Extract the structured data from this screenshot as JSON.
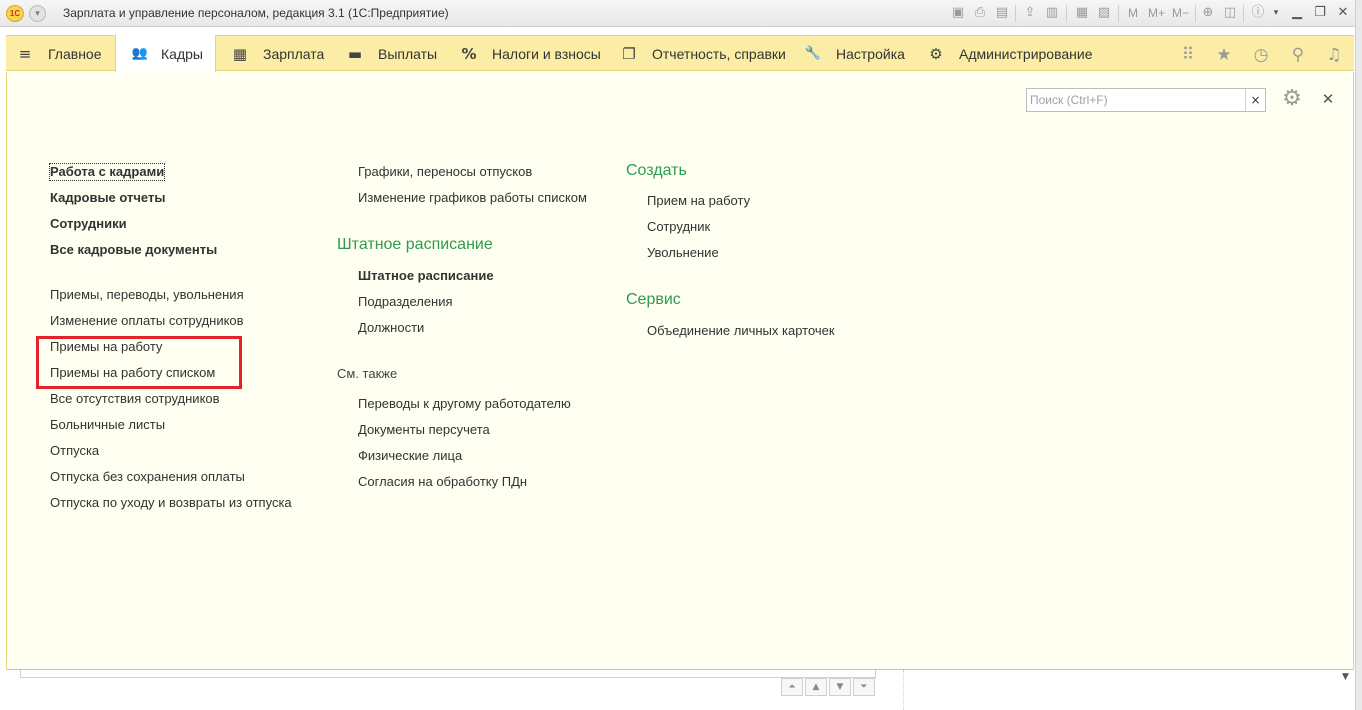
{
  "window": {
    "title": "Зарплата и управление персоналом, редакция 3.1  (1С:Предприятие)",
    "logo_text": "1С",
    "toolbar_text": {
      "m": "M",
      "m_plus": "M+",
      "m_minus": "M−"
    }
  },
  "nav": {
    "items": [
      {
        "label": "Главное",
        "icon": "hamburger-icon",
        "glyph": "≡"
      },
      {
        "label": "Кадры",
        "icon": "people-icon",
        "glyph": "👥",
        "active": true
      },
      {
        "label": "Зарплата",
        "icon": "calculator-icon",
        "glyph": "▦"
      },
      {
        "label": "Выплаты",
        "icon": "wallet-icon",
        "glyph": "▬"
      },
      {
        "label": "Налоги и взносы",
        "icon": "percent-icon",
        "glyph": "%"
      },
      {
        "label": "Отчетность, справки",
        "icon": "documents-icon",
        "glyph": "❐"
      },
      {
        "label": "Настройка",
        "icon": "wrench-icon",
        "glyph": "🔧"
      },
      {
        "label": "Администрирование",
        "icon": "gear-icon",
        "glyph": "⚙"
      }
    ],
    "right_icons": [
      "apps-grid-icon",
      "favorites-star-icon",
      "history-icon",
      "search-icon",
      "notifications-bell-icon"
    ]
  },
  "search": {
    "placeholder": "Поиск (Ctrl+F)",
    "value": ""
  },
  "columns": {
    "left": {
      "main_links": [
        "Работа с кадрами",
        "Кадровые отчеты",
        "Сотрудники",
        "Все кадровые документы"
      ],
      "doc_links": [
        "Приемы, переводы, увольнения",
        "Изменение оплаты сотрудников",
        "Приемы на работу",
        "Приемы на работу списком",
        "Все отсутствия сотрудников",
        "Больничные листы",
        "Отпуска",
        "Отпуска без сохранения оплаты",
        "Отпуска по уходу и возвраты из отпуска"
      ]
    },
    "middle": {
      "top_links": [
        "Графики, переносы отпусков",
        "Изменение графиков работы списком"
      ],
      "staffing_title": "Штатное расписание",
      "staffing_links": [
        "Штатное расписание",
        "Подразделения",
        "Должности"
      ],
      "see_also_title": "См. также",
      "see_also_links": [
        "Переводы к другому работодателю",
        "Документы персучета",
        "Физические лица",
        "Согласия на обработку ПДн"
      ]
    },
    "right": {
      "create_title": "Создать",
      "create_links": [
        "Прием на работу",
        "Сотрудник",
        "Увольнение"
      ],
      "service_title": "Сервис",
      "service_links": [
        "Объединение личных карточек"
      ]
    }
  },
  "colors": {
    "nav_bg": "#fbeda5",
    "panel_bg": "#fffff1",
    "group_title": "#2f9a52",
    "highlight": "#e3232b"
  }
}
